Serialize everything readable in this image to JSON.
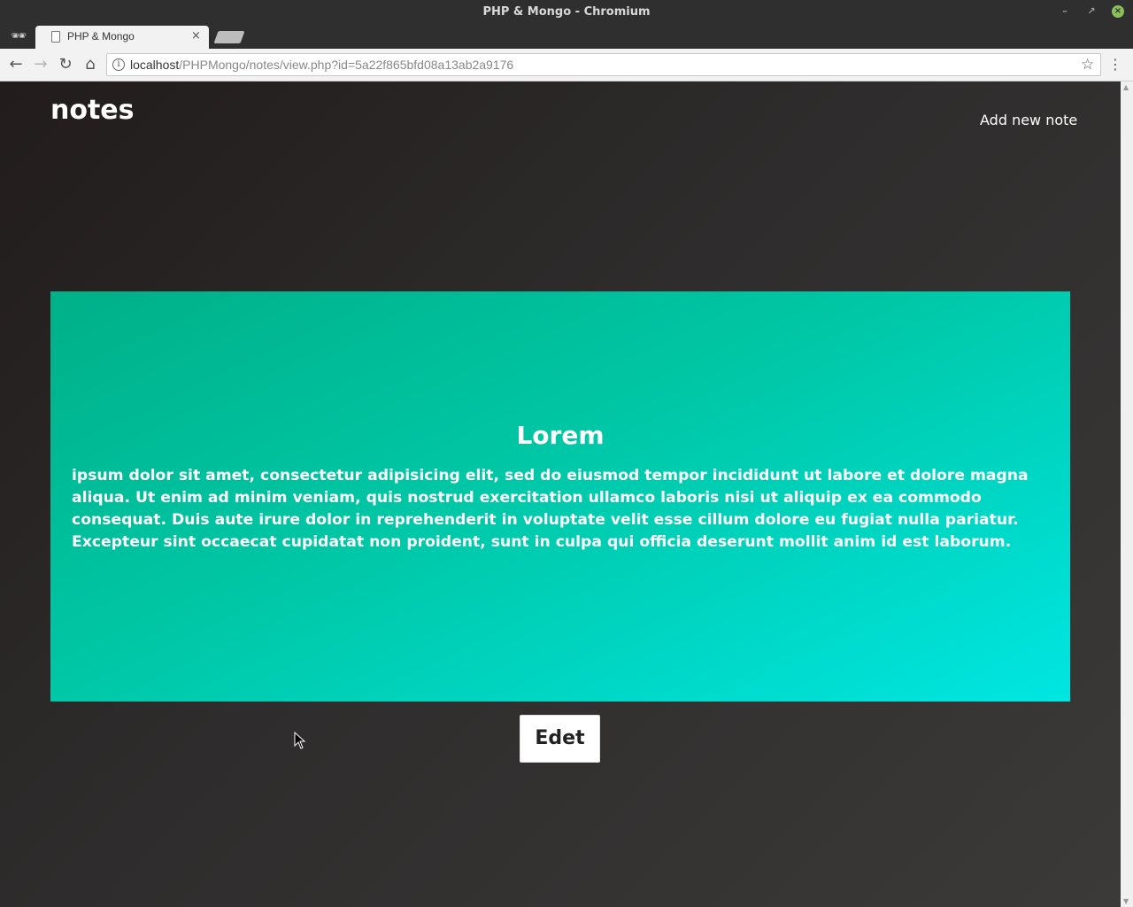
{
  "window": {
    "title": "PHP & Mongo - Chromium"
  },
  "browser": {
    "tab_title": "PHP & Mongo",
    "url_host": "localhost",
    "url_path": "/PHPMongo/notes/view.php?id=5a22f865bfd08a13ab2a9176"
  },
  "page": {
    "site_title": "notes",
    "add_link": "Add new note",
    "note": {
      "title": "Lorem",
      "body": "ipsum dolor sit amet, consectetur adipisicing elit, sed do eiusmod tempor incididunt ut labore et dolore magna aliqua. Ut enim ad minim veniam, quis nostrud exercitation ullamco laboris nisi ut aliquip ex ea commodo consequat. Duis aute irure dolor in reprehenderit in voluptate velit esse cillum dolore eu fugiat nulla pariatur. Excepteur sint occaecat cupidatat non proident, sunt in culpa qui officia deserunt mollit anim id est laborum."
    },
    "edit_button": "Edet"
  },
  "colors": {
    "card_gradient_start": "#00b088",
    "card_gradient_end": "#00e6e2",
    "page_background": "#2b2b2b"
  },
  "icons": {
    "incognito": "incognito-icon",
    "back": "arrow-left-icon",
    "forward": "arrow-right-icon",
    "reload": "reload-icon",
    "home": "home-icon",
    "info": "info-icon",
    "bookmark": "star-icon",
    "menu": "kebab-menu-icon"
  }
}
